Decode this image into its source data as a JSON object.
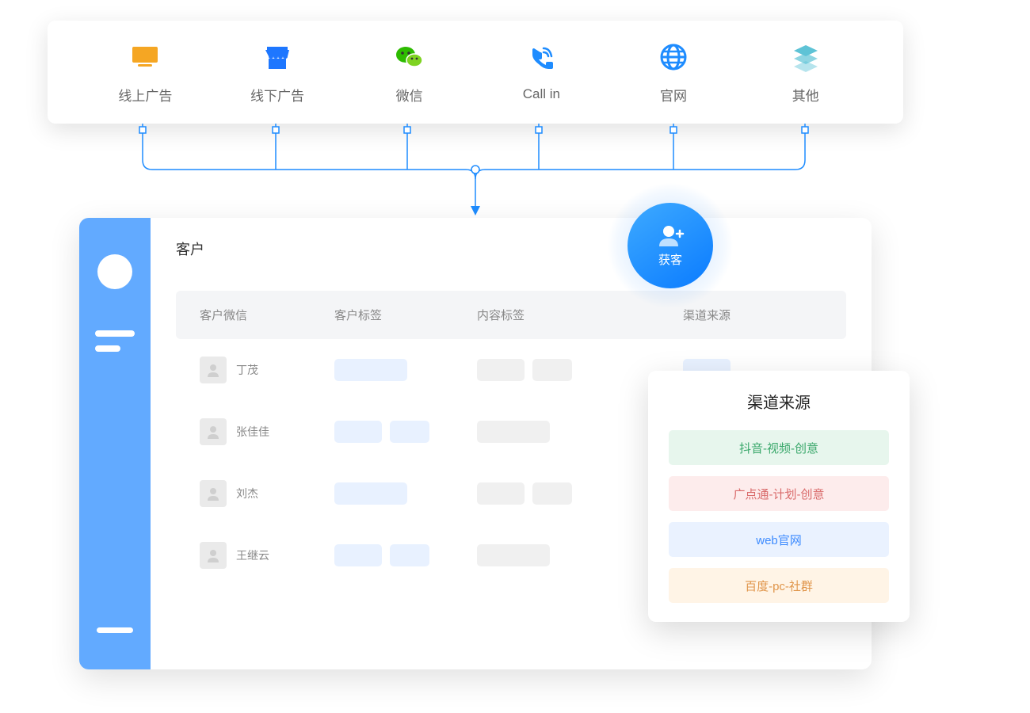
{
  "channels": [
    {
      "label": "线上广告",
      "icon": "monitor",
      "color": "#f5a623"
    },
    {
      "label": "线下广告",
      "icon": "store",
      "color": "#1e77ff"
    },
    {
      "label": "微信",
      "icon": "wechat",
      "color": "#2dbb00"
    },
    {
      "label": "Call in",
      "icon": "phone",
      "color": "#1e8cff"
    },
    {
      "label": "官网",
      "icon": "globe",
      "color": "#1e8cff"
    },
    {
      "label": "其他",
      "icon": "layers",
      "color": "#5ec3d6"
    }
  ],
  "acquire": {
    "label": "获客"
  },
  "panel": {
    "title": "客户",
    "columns": [
      "客户微信",
      "客户标签",
      "内容标签",
      "渠道来源"
    ],
    "rows": [
      {
        "name": "丁茂",
        "tags": [
          {
            "t": "blue",
            "w": "w90"
          }
        ],
        "content": [
          {
            "t": "gray",
            "w": "w60"
          },
          {
            "t": "gray",
            "w": "w50"
          }
        ],
        "source": [
          {
            "t": "blue",
            "w": "w60"
          }
        ]
      },
      {
        "name": "张佳佳",
        "tags": [
          {
            "t": "blue",
            "w": "w60"
          },
          {
            "t": "blue",
            "w": "w50"
          }
        ],
        "content": [
          {
            "t": "gray",
            "w": "w90"
          }
        ],
        "source": [
          {
            "t": "blue",
            "w": "w60"
          }
        ]
      },
      {
        "name": "刘杰",
        "tags": [
          {
            "t": "blue",
            "w": "w90"
          }
        ],
        "content": [
          {
            "t": "gray",
            "w": "w60"
          },
          {
            "t": "gray",
            "w": "w50"
          }
        ],
        "source": [
          {
            "t": "blue",
            "w": "w60"
          }
        ]
      },
      {
        "name": "王继云",
        "tags": [
          {
            "t": "blue",
            "w": "w60"
          },
          {
            "t": "blue",
            "w": "w50"
          }
        ],
        "content": [
          {
            "t": "gray",
            "w": "w90"
          }
        ],
        "source": [
          {
            "t": "blue",
            "w": "w60"
          }
        ]
      }
    ]
  },
  "sourcePopup": {
    "title": "渠道来源",
    "items": [
      {
        "label": "抖音-视频-创意",
        "bg": "#e7f6ed",
        "fg": "#3aa86b"
      },
      {
        "label": "广点通-计划-创意",
        "bg": "#fdecec",
        "fg": "#d96a6a"
      },
      {
        "label": "web官网",
        "bg": "#eaf2ff",
        "fg": "#3d8bff"
      },
      {
        "label": "百度-pc-社群",
        "bg": "#fff4e6",
        "fg": "#e0954a"
      }
    ]
  }
}
